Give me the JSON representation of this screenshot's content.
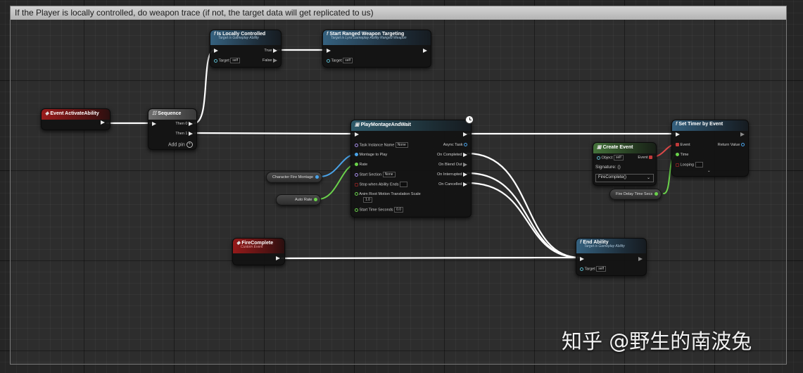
{
  "comment": {
    "text": "If the Player is locally controlled, do weapon trace (if not, the target data will get replicated to us)"
  },
  "nodes": {
    "event_activate": {
      "title": "Event ActivateAbility"
    },
    "sequence": {
      "title": "Sequence",
      "then0": "Then 0",
      "then1": "Then 1",
      "add_pin": "Add pin"
    },
    "is_locally": {
      "title": "Is Locally Controlled",
      "subtitle": "Target is Gameplay Ability",
      "true_label": "True",
      "false_label": "False",
      "target_label": "Target",
      "target_value": "self"
    },
    "start_ranged": {
      "title": "Start Ranged Weapon Targeting",
      "subtitle": "Target is Lyra Gameplay Ability Ranged Weapon",
      "target_label": "Target",
      "target_value": "self"
    },
    "play_montage": {
      "title": "PlayMontageAndWait",
      "task_instance_name": "Task Instance Name",
      "task_instance_value": "None",
      "montage_to_play": "Montage to Play",
      "rate": "Rate",
      "start_section": "Start Section",
      "start_section_value": "None",
      "stop_when_ability_ends": "Stop when Ability Ends",
      "anim_root_motion": "Anim Root Motion Translation Scale",
      "anim_root_motion_value": "1.0",
      "start_time_seconds": "Start Time Seconds",
      "start_time_value": "0.0",
      "async_task": "Async Task",
      "on_completed": "On Completed",
      "on_blend_out": "On Blend Out",
      "on_interrupted": "On Interrupted",
      "on_cancelled": "On Cancelled"
    },
    "create_event": {
      "title": "Create Event",
      "object_label": "Object",
      "object_value": "self",
      "event_label": "Event",
      "signature_label": "Signature: ()",
      "dropdown_value": "FireComplete()"
    },
    "set_timer": {
      "title": "Set Timer by Event",
      "event_label": "Event",
      "time_label": "Time",
      "looping_label": "Looping",
      "return_value": "Return Value"
    },
    "fire_complete": {
      "title": "FireComplete",
      "subtitle": "Custom Event"
    },
    "end_ability": {
      "title": "End Ability",
      "subtitle": "Target is Gameplay Ability",
      "target_label": "Target",
      "target_value": "self"
    }
  },
  "variables": {
    "character_fire_montage": "Character Fire Montage",
    "auto_rate": "Auto Rate",
    "fire_delay_time_secs": "Fire Delay Time Secs"
  },
  "icons": {
    "function": "function-icon",
    "event": "event-diamond-icon",
    "sequence": "sequence-icon",
    "clock": "clock-icon",
    "chevron": "chevron-down-icon"
  },
  "watermark": "知乎 @野生的南波兔",
  "colors": {
    "exec_wire": "#ffffff",
    "object_wire": "#4aa3e8",
    "float_wire": "#6ad24b",
    "delegate_wire": "#e04a4a",
    "comment_header": "#c8c8c8"
  }
}
